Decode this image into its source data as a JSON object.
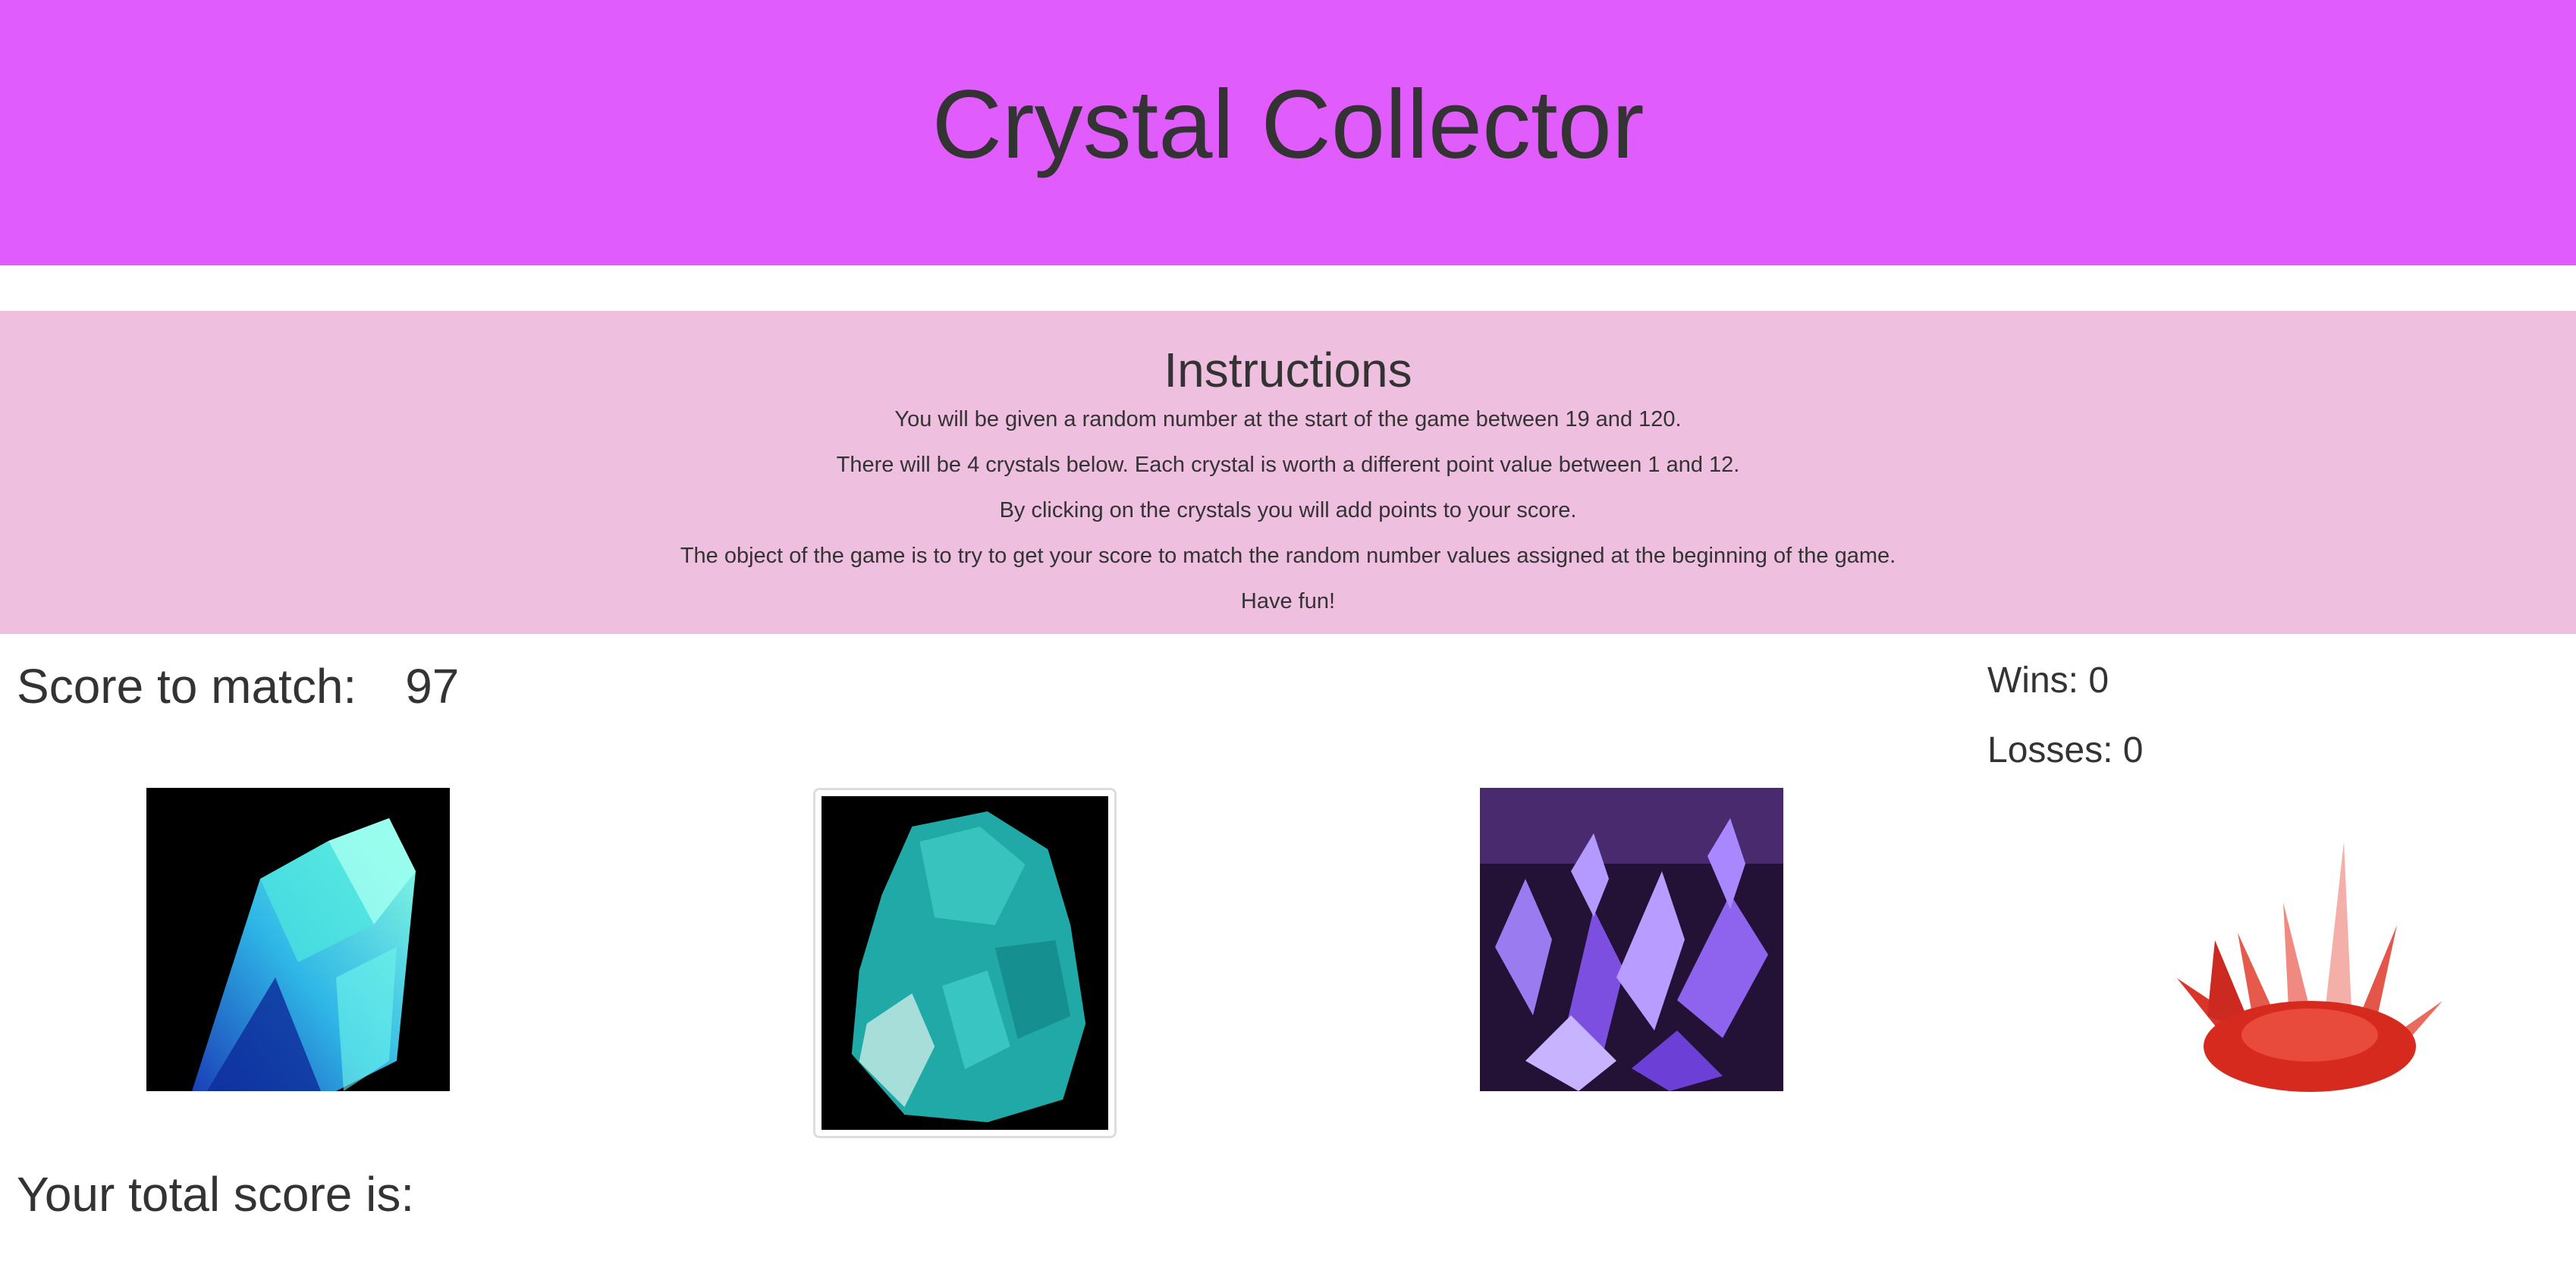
{
  "header": {
    "title": "Crystal Collector"
  },
  "instructions": {
    "heading": "Instructions",
    "lines": [
      "You will be given a random number at the start of the game between 19 and 120.",
      "There will be 4 crystals below. Each crystal is worth a different point value between 1 and 12.",
      "By clicking on the crystals you will add points to your score.",
      "The object of the game is to try to get your score to match the random number values assigned at the beginning of the game.",
      "Have fun!"
    ]
  },
  "game": {
    "score_to_match_label": "Score to match:",
    "score_to_match_value": "97",
    "wins_label": "Wins: 0",
    "losses_label": "Losses: 0",
    "total_score_label": "Your total score is:"
  },
  "crystals": [
    {
      "name": "blue-crystal",
      "color": "#2fe0d8"
    },
    {
      "name": "teal-crystal",
      "color": "#21a9a8"
    },
    {
      "name": "purple-crystal",
      "color": "#8a55e6"
    },
    {
      "name": "red-crystal",
      "color": "#d62a1e"
    }
  ],
  "colors": {
    "header_bg": "#e05cfd",
    "instructions_bg": "#eebfdf",
    "text": "#333333"
  }
}
